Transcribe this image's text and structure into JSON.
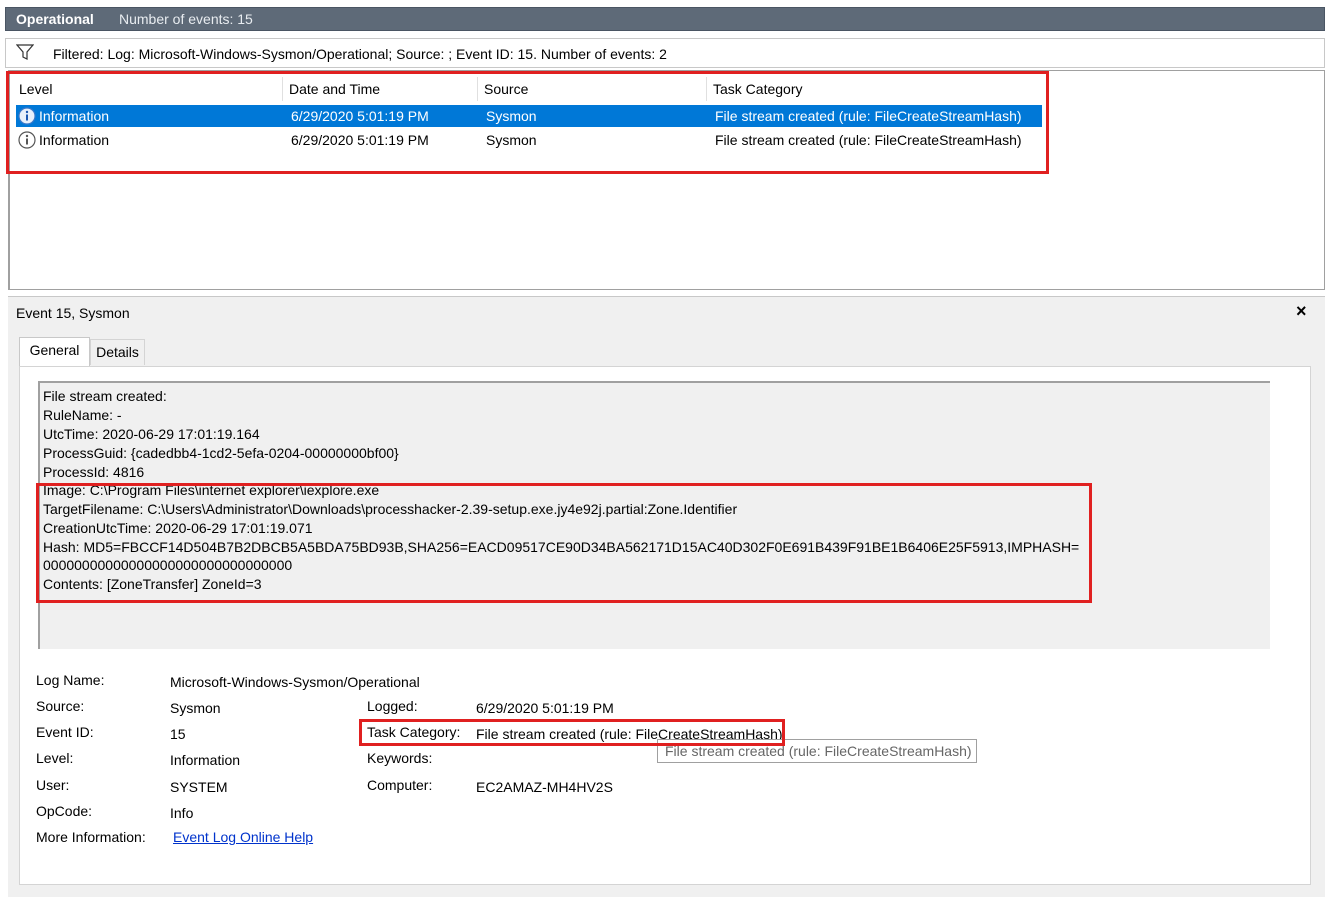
{
  "header": {
    "log_name": "Operational",
    "event_count": "Number of events: 15"
  },
  "filter": {
    "text": "Filtered: Log: Microsoft-Windows-Sysmon/Operational; Source: ; Event ID: 15. Number of events: 2"
  },
  "event_list": {
    "columns": [
      "Level",
      "Date and Time",
      "Source",
      "Task Category"
    ],
    "rows": [
      {
        "level": "Information",
        "datetime": "6/29/2020 5:01:19 PM",
        "source": "Sysmon",
        "task_category": "File stream created (rule: FileCreateStreamHash)",
        "selected": true
      },
      {
        "level": "Information",
        "datetime": "6/29/2020 5:01:19 PM",
        "source": "Sysmon",
        "task_category": "File stream created (rule: FileCreateStreamHash)",
        "selected": false
      }
    ]
  },
  "event_panel": {
    "title": "Event 15, Sysmon",
    "close_glyph": "×",
    "tabs": [
      "General",
      "Details"
    ],
    "description_lines": [
      "File stream created:",
      "RuleName: -",
      "UtcTime: 2020-06-29 17:01:19.164",
      "ProcessGuid: {cadedbb4-1cd2-5efa-0204-00000000bf00}",
      "ProcessId: 4816",
      "Image: C:\\Program Files\\internet explorer\\iexplore.exe",
      "TargetFilename: C:\\Users\\Administrator\\Downloads\\processhacker-2.39-setup.exe.jy4e92j.partial:Zone.Identifier",
      "CreationUtcTime: 2020-06-29 17:01:19.071",
      "Hash: MD5=FBCCF14D504B7B2DBCB5A5BDA75BD93B,SHA256=EACD09517CE90D34BA562171D15AC40D302F0E691B439F91BE1B6406E25F5913,IMPHASH=",
      "00000000000000000000000000000000",
      "Contents: [ZoneTransfer]  ZoneId=3"
    ],
    "properties": {
      "log_name_label": "Log Name:",
      "log_name_value": "Microsoft-Windows-Sysmon/Operational",
      "source_label": "Source:",
      "source_value": "Sysmon",
      "logged_label": "Logged:",
      "logged_value": "6/29/2020 5:01:19 PM",
      "event_id_label": "Event ID:",
      "event_id_value": "15",
      "task_category_label": "Task Category:",
      "task_category_value": "File stream created (rule: FileCreateStreamHash)",
      "level_label": "Level:",
      "level_value": "Information",
      "keywords_label": "Keywords:",
      "keywords_value": "",
      "user_label": "User:",
      "user_value": "SYSTEM",
      "computer_label": "Computer:",
      "computer_value": "EC2AMAZ-MH4HV2S",
      "opcode_label": "OpCode:",
      "opcode_value": "Info",
      "more_info_label": "More Information:",
      "more_info_link": "Event Log Online Help"
    },
    "tooltip": "File stream created (rule: FileCreateStreamHash)"
  },
  "colors": {
    "header_bg": "#5e6a78",
    "selection": "#0078d7",
    "highlight_box": "#e02020",
    "link": "#0033cc"
  },
  "icons": [
    "filter-icon",
    "information-icon",
    "close-icon"
  ]
}
